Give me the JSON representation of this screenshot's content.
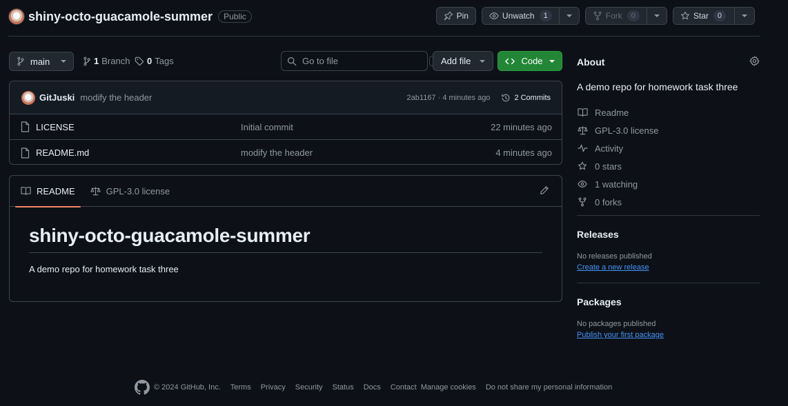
{
  "repo": {
    "name": "shiny-octo-guacamole-summer",
    "visibility": "Public"
  },
  "header_actions": {
    "pin": "Pin",
    "unwatch": "Unwatch",
    "unwatch_count": "1",
    "fork": "Fork",
    "fork_count": "0",
    "star": "Star",
    "star_count": "0"
  },
  "toolbar": {
    "branch": "main",
    "branch_count": "1",
    "branch_label": "Branch",
    "tag_count": "0",
    "tag_label": "Tags",
    "search_placeholder": "Go to file",
    "search_shortcut": "t",
    "add_file": "Add file",
    "code": "Code"
  },
  "latest_commit": {
    "author": "GitJuski",
    "message": "modify the header",
    "meta": "2ab1167 · 4 minutes ago",
    "commits_label": "2 Commits"
  },
  "files": [
    {
      "name": "LICENSE",
      "commit": "Initial commit",
      "time": "22 minutes ago"
    },
    {
      "name": "README.md",
      "commit": "modify the header",
      "time": "4 minutes ago"
    }
  ],
  "readme": {
    "tab_readme": "README",
    "tab_license": "GPL-3.0 license",
    "heading": "shiny-octo-guacamole-summer",
    "body": "A demo repo for homework task three"
  },
  "about": {
    "title": "About",
    "description": "A demo repo for homework task three",
    "items": [
      {
        "icon": "book-icon",
        "label": "Readme"
      },
      {
        "icon": "scale-icon",
        "label": "GPL-3.0 license"
      },
      {
        "icon": "pulse-icon",
        "label": "Activity"
      },
      {
        "icon": "star-icon",
        "label": "0 stars"
      },
      {
        "icon": "eye-icon",
        "label": "1 watching"
      },
      {
        "icon": "fork-icon",
        "label": "0 forks"
      }
    ]
  },
  "releases": {
    "title": "Releases",
    "status": "No releases published",
    "link": "Create a new release"
  },
  "packages": {
    "title": "Packages",
    "status": "No packages published",
    "link": "Publish your first package"
  },
  "footer": {
    "copyright": "© 2024 GitHub, Inc.",
    "links": [
      "Terms",
      "Privacy",
      "Security",
      "Status",
      "Docs",
      "Contact",
      "Manage cookies",
      "Do not share my personal information"
    ]
  },
  "colors": {
    "accent": "#4493f8",
    "primary_button": "#238636",
    "tab_underline": "#f78166",
    "background": "#0d1117"
  }
}
